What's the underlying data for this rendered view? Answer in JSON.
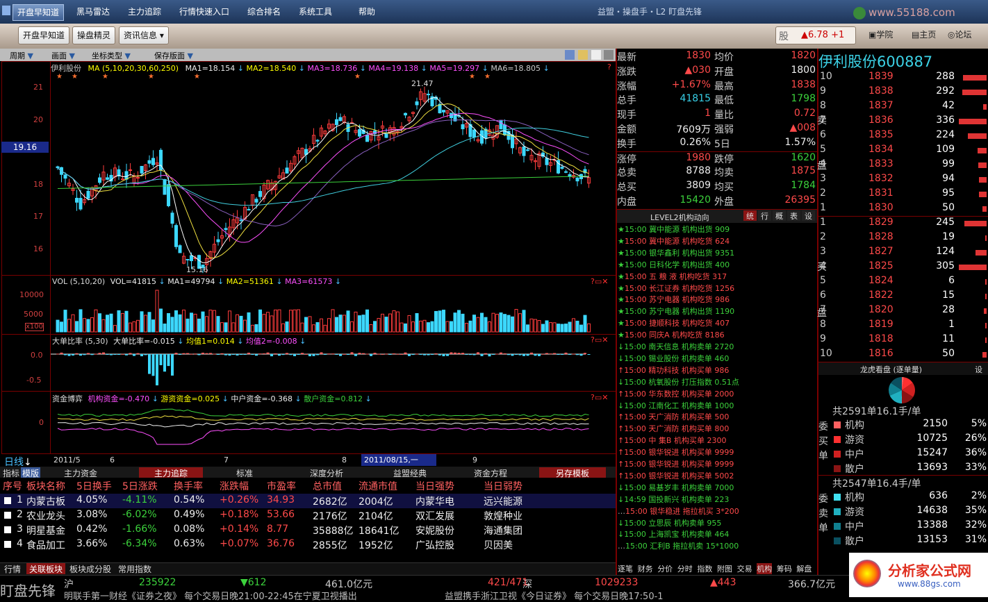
{
  "menu": {
    "items": [
      "开盘早知道",
      "黑马雷达",
      "主力追踪",
      "行情快速入口",
      "综合排名",
      "系统工具",
      "帮助"
    ],
    "app_title": "益盟・操盘手・L2 盯盘先锋",
    "watermark_top": "www.55188.com"
  },
  "toolbar": {
    "buttons": [
      "开盘早知道",
      "操盘精灵",
      "资讯信息"
    ],
    "ticker": "▲6.78 +1",
    "stock_short": "股",
    "links": [
      "学院",
      "主页",
      "论坛"
    ]
  },
  "chart_toolbar": {
    "items": [
      "周期",
      "画面",
      "坐标类型",
      "保存版面"
    ]
  },
  "main_chart": {
    "name": "伊利股份",
    "ma_label": "MA (5,10,20,30,60,250)",
    "ma": [
      "MA1=18.154",
      "MA2=18.540",
      "MA3=18.736",
      "MA4=19.138",
      "MA5=19.297",
      "MA6=18.805"
    ],
    "y_ticks": [
      "21",
      "20",
      "19.16",
      "18",
      "17",
      "16"
    ],
    "high": "21.47",
    "low": "15.16",
    "colors": {
      "up": "#ff3c3c",
      "down": "#3cd8ff"
    }
  },
  "vol_panel": {
    "label": "VOL (5,10,20)",
    "values": [
      "VOL=41815",
      "MA1=49794",
      "MA2=51361",
      "MA3=61573"
    ],
    "y_ticks": [
      "10000",
      "5000",
      "x100"
    ]
  },
  "dadan_panel": {
    "label": "大单比率 (5,30)",
    "values": [
      "大单比率=-0.015",
      "均值1=0.014",
      "均值2=-0.008"
    ],
    "y_ticks": [
      "0.0",
      "-0.5"
    ]
  },
  "zijin_panel": {
    "label": "资金博弈",
    "values": [
      "机构资金=-0.470",
      "游资资金=0.025",
      "中户资金=-0.368",
      "散户资金=0.812"
    ],
    "y_ticks": [
      "0"
    ]
  },
  "time_axis": {
    "period": "日线",
    "labels": [
      "2011/5",
      "6",
      "7",
      "8",
      "2011/08/15,一",
      "9"
    ]
  },
  "quote": {
    "rows": [
      {
        "l1": "最新",
        "v1": "1830",
        "l2": "均价",
        "v2": "1820"
      },
      {
        "l1": "涨跌",
        "v1": "▲030",
        "l2": "开盘",
        "v2": "1800"
      },
      {
        "l1": "涨幅",
        "v1": "+1.67%",
        "l2": "最高",
        "v2": "1838"
      },
      {
        "l1": "总手",
        "v1": "41815",
        "l2": "最低",
        "v2": "1798"
      },
      {
        "l1": "现手",
        "v1": "1",
        "l2": "量比",
        "v2": "0.72"
      },
      {
        "l1": "金额",
        "v1": "7609万",
        "l2": "强弱",
        "v2": "▲008"
      },
      {
        "l1": "换手",
        "v1": "0.26%",
        "l2": "5日",
        "v2": "1.57%"
      },
      {
        "l1": "涨停",
        "v1": "1980",
        "l2": "跌停",
        "v2": "1620"
      },
      {
        "l1": "总卖",
        "v1": "8788",
        "l2": "均卖",
        "v2": "1875"
      },
      {
        "l1": "总买",
        "v1": "3809",
        "l2": "均买",
        "v2": "1784"
      },
      {
        "l1": "内盘",
        "v1": "15420",
        "l2": "外盘",
        "v2": "26395"
      }
    ]
  },
  "book": {
    "title": "伊利股份600887",
    "sell_label": [
      "卖",
      "盘"
    ],
    "buy_label": [
      "买",
      "盘"
    ],
    "sell": [
      {
        "lv": "10",
        "p": "1839",
        "v": "288",
        "w": 0.86
      },
      {
        "lv": "9",
        "p": "1838",
        "v": "292",
        "w": 0.87
      },
      {
        "lv": "8",
        "p": "1837",
        "v": "42",
        "w": 0.13
      },
      {
        "lv": "7",
        "p": "1836",
        "v": "336",
        "w": 1.0
      },
      {
        "lv": "6",
        "p": "1835",
        "v": "224",
        "w": 0.67
      },
      {
        "lv": "5",
        "p": "1834",
        "v": "109",
        "w": 0.32
      },
      {
        "lv": "4",
        "p": "1833",
        "v": "99",
        "w": 0.29
      },
      {
        "lv": "3",
        "p": "1832",
        "v": "94",
        "w": 0.28
      },
      {
        "lv": "2",
        "p": "1831",
        "v": "95",
        "w": 0.28
      },
      {
        "lv": "1",
        "p": "1830",
        "v": "50",
        "w": 0.15
      }
    ],
    "buy": [
      {
        "lv": "1",
        "p": "1829",
        "v": "245",
        "w": 0.8
      },
      {
        "lv": "2",
        "p": "1828",
        "v": "19",
        "w": 0.06
      },
      {
        "lv": "3",
        "p": "1827",
        "v": "124",
        "w": 0.41
      },
      {
        "lv": "4",
        "p": "1825",
        "v": "305",
        "w": 1.0
      },
      {
        "lv": "5",
        "p": "1824",
        "v": "6",
        "w": 0.02
      },
      {
        "lv": "6",
        "p": "1822",
        "v": "15",
        "w": 0.05
      },
      {
        "lv": "7",
        "p": "1820",
        "v": "28",
        "w": 0.09
      },
      {
        "lv": "8",
        "p": "1819",
        "v": "1",
        "w": 0.01
      },
      {
        "lv": "9",
        "p": "1818",
        "v": "11",
        "w": 0.04
      },
      {
        "lv": "10",
        "p": "1816",
        "v": "50",
        "w": 0.16
      }
    ]
  },
  "feed": {
    "title": "LEVEL2机构动向",
    "tabs": [
      "统",
      "行",
      "概",
      "表",
      "设"
    ],
    "rows": [
      {
        "m": "★",
        "t": "15:00",
        "n": "冀中能源",
        "a": "机构出货",
        "v": "909",
        "c": "g"
      },
      {
        "m": "★",
        "t": "15:00",
        "n": "冀中能源",
        "a": "机构吃货",
        "v": "624",
        "c": "r"
      },
      {
        "m": "★",
        "t": "15:00",
        "n": "银华鑫利",
        "a": "机构出货",
        "v": "9351",
        "c": "g"
      },
      {
        "m": "★",
        "t": "15:00",
        "n": "日科化学",
        "a": "机构出货",
        "v": "400",
        "c": "g"
      },
      {
        "m": "★",
        "t": "15:00",
        "n": "五 粮 液",
        "a": "机构吃货",
        "v": "317",
        "c": "r"
      },
      {
        "m": "★",
        "t": "15:00",
        "n": "长江证券",
        "a": "机构吃货",
        "v": "1256",
        "c": "r"
      },
      {
        "m": "★",
        "t": "15:00",
        "n": "苏宁电器",
        "a": "机构吃货",
        "v": "986",
        "c": "r"
      },
      {
        "m": "★",
        "t": "15:00",
        "n": "苏宁电器",
        "a": "机构出货",
        "v": "1190",
        "c": "g"
      },
      {
        "m": "★",
        "t": "15:00",
        "n": "捷顺科技",
        "a": "机构吃货",
        "v": "407",
        "c": "r"
      },
      {
        "m": "★",
        "t": "15:00",
        "n": "同庆A",
        "a": "机构吃货",
        "v": "8186",
        "c": "r"
      },
      {
        "m": "↓",
        "t": "15:00",
        "n": "南天信息",
        "a": "机构卖单",
        "v": "2720",
        "c": "g"
      },
      {
        "m": "↓",
        "t": "15:00",
        "n": "锡业股份",
        "a": "机构卖单",
        "v": "460",
        "c": "g"
      },
      {
        "m": "↑",
        "t": "15:00",
        "n": "精功科技",
        "a": "机构买单",
        "v": "986",
        "c": "r"
      },
      {
        "m": "↓",
        "t": "15:00",
        "n": "杭氧股份",
        "a": "打压指数",
        "v": "0.51点",
        "c": "g"
      },
      {
        "m": "↑",
        "t": "15:00",
        "n": "华东数控",
        "a": "机构买单",
        "v": "2000",
        "c": "r"
      },
      {
        "m": "↓",
        "t": "15:00",
        "n": "江南化工",
        "a": "机构卖单",
        "v": "1000",
        "c": "g"
      },
      {
        "m": "↑",
        "t": "15:00",
        "n": "天广消防",
        "a": "机构买单",
        "v": "500",
        "c": "r"
      },
      {
        "m": "↑",
        "t": "15:00",
        "n": "天广消防",
        "a": "机构买单",
        "v": "800",
        "c": "r"
      },
      {
        "m": "↑",
        "t": "15:00",
        "n": "中 集B",
        "a": "机构买单",
        "v": "2300",
        "c": "r"
      },
      {
        "m": "↑",
        "t": "15:00",
        "n": "银华锐进",
        "a": "机构买单",
        "v": "9999",
        "c": "r"
      },
      {
        "m": "↑",
        "t": "15:00",
        "n": "银华锐进",
        "a": "机构买单",
        "v": "9999",
        "c": "r"
      },
      {
        "m": "↑",
        "t": "15:00",
        "n": "银华锐进",
        "a": "机构买单",
        "v": "5002",
        "c": "r"
      },
      {
        "m": "↓",
        "t": "15:00",
        "n": "易基岁丰",
        "a": "机构卖单",
        "v": "7000",
        "c": "g"
      },
      {
        "m": "↓",
        "t": "14:59",
        "n": "国投新兴",
        "a": "机构卖单",
        "v": "223",
        "c": "g"
      },
      {
        "m": "…",
        "t": "15:00",
        "n": "银华稳进",
        "a": "拖拉机买",
        "v": "3*200",
        "c": "r"
      },
      {
        "m": "↓",
        "t": "15:00",
        "n": "立思辰",
        "a": "机构卖单",
        "v": "955",
        "c": "g"
      },
      {
        "m": "↓",
        "t": "15:00",
        "n": "上海凯宝",
        "a": "机构卖单",
        "v": "464",
        "c": "g"
      },
      {
        "m": "…",
        "t": "15:00",
        "n": "汇利B",
        "a": "拖拉机卖",
        "v": "15*1000",
        "c": "g"
      }
    ],
    "bottom_tabs": [
      "逐笔",
      "财务",
      "分价",
      "分时",
      "指数",
      "附图",
      "交易",
      "机构",
      "筹码",
      "解盘"
    ]
  },
  "dragon": {
    "title": "龙虎看盘 (逐单量)",
    "set": "设",
    "buy_summary": "共2591单16.1手/单",
    "sell_summary": "共2547单16.4手/单",
    "buy_label": [
      "委",
      "买",
      "单"
    ],
    "sell_label": [
      "委",
      "卖",
      "单"
    ],
    "buy": [
      {
        "n": "机构",
        "v": "2150",
        "p": "5%",
        "c": "#ff6060"
      },
      {
        "n": "游资",
        "v": "10725",
        "p": "26%",
        "c": "#ff3030"
      },
      {
        "n": "中户",
        "v": "15247",
        "p": "36%",
        "c": "#d02020"
      },
      {
        "n": "散户",
        "v": "13693",
        "p": "33%",
        "c": "#8a1414"
      }
    ],
    "sell": [
      {
        "n": "机构",
        "v": "636",
        "p": "2%",
        "c": "#40e0f0"
      },
      {
        "n": "游资",
        "v": "14638",
        "p": "35%",
        "c": "#20b0c0"
      },
      {
        "n": "中户",
        "v": "13388",
        "p": "32%",
        "c": "#108090"
      },
      {
        "n": "散户",
        "v": "13153",
        "p": "31%",
        "c": "#0a5060"
      }
    ]
  },
  "sector_table": {
    "mid_tabs": [
      "指标",
      "模版",
      "主力资金",
      "主力追踪",
      "标准",
      "深度分析",
      "益盟经典",
      "资金方程",
      "另存模板"
    ],
    "headers": [
      "序号",
      "板块名称",
      "5日换手",
      "5日涨跌",
      "换手率",
      "涨跌幅",
      "市盈率",
      "总市值",
      "流通市值",
      "当日强势",
      "当日弱势"
    ],
    "rows": [
      {
        "i": "1",
        "name": "内蒙古板",
        "t5": "4.05%",
        "c5": "-4.11%",
        "tr": "0.54%",
        "ch": "+0.26%",
        "pe": "34.93",
        "mv": "2682亿",
        "fv": "2004亿",
        "s": "内蒙华电",
        "w": "远兴能源"
      },
      {
        "i": "2",
        "name": "农业龙头",
        "t5": "3.08%",
        "c5": "-6.02%",
        "tr": "0.49%",
        "ch": "+0.18%",
        "pe": "53.66",
        "mv": "2176亿",
        "fv": "2104亿",
        "s": "双汇发展",
        "w": "敦煌种业"
      },
      {
        "i": "3",
        "name": "明星基金",
        "t5": "0.42%",
        "c5": "-1.66%",
        "tr": "0.08%",
        "ch": "+0.14%",
        "pe": "8.77",
        "mv": "35888亿",
        "fv": "18641亿",
        "s": "安妮股份",
        "w": "海通集团"
      },
      {
        "i": "4",
        "name": "食品加工",
        "t5": "3.66%",
        "c5": "-6.34%",
        "tr": "0.63%",
        "ch": "+0.07%",
        "pe": "36.76",
        "mv": "2855亿",
        "fv": "1952亿",
        "s": "广弘控股",
        "w": "贝因美"
      }
    ],
    "bottom_tabs": [
      "行情",
      "关联板块",
      "板块成分股",
      "常用指数"
    ]
  },
  "status": {
    "left": "盯盘先锋",
    "sh": "沪",
    "sh_idx": "235922",
    "sh_chg": "▼612",
    "sh_amt": "461.0亿元",
    "sh_ud": "421/471",
    "sz": "深",
    "sz_idx": "1029233",
    "sz_chg": "▲443",
    "sz_amt": "366.7亿元",
    "ticker1": "明联手第一财经《证券之夜》 每个交易日晚21:00-22:45在宁夏卫视播出",
    "ticker2": "益盟携手浙江卫视《今日证券》 每个交易日晚17:50-1",
    "logo": "分析家公式网",
    "logo_url": "www.88gs.com"
  }
}
